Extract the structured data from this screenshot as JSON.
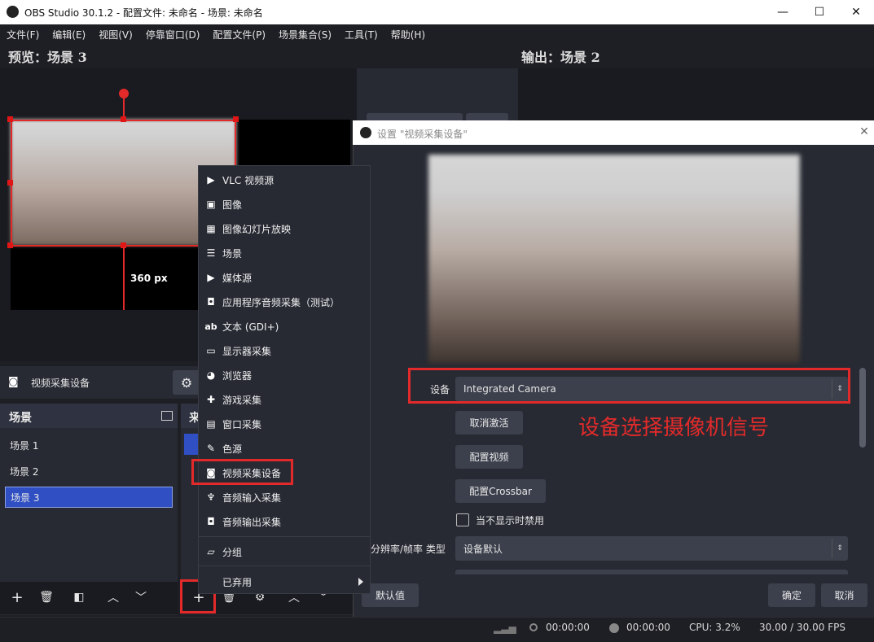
{
  "window": {
    "title": "OBS Studio 30.1.2 - 配置文件: 未命名 - 场景: 未命名",
    "minimize": "—",
    "maximize": "☐",
    "close": "✕"
  },
  "menu": [
    "文件(F)",
    "编辑(E)",
    "视图(V)",
    "停靠窗口(D)",
    "配置文件(P)",
    "场景集合(S)",
    "工具(T)",
    "帮助(H)"
  ],
  "preview": {
    "label": "预览：场景 3",
    "size_label": "360 px"
  },
  "program": {
    "label": "输出：场景 2"
  },
  "source_bar": {
    "name": "视频采集设备"
  },
  "scenes": {
    "title": "场景",
    "items": [
      "场景 1",
      "场景 2",
      "场景 3"
    ],
    "selected_index": 2
  },
  "sources_panel": {
    "title_partial": "来"
  },
  "context_menu": {
    "items": [
      {
        "icon": "play-icon",
        "label": "VLC 视频源"
      },
      {
        "icon": "image-icon",
        "label": "图像"
      },
      {
        "icon": "slideshow-icon",
        "label": "图像幻灯片放映"
      },
      {
        "icon": "list-icon",
        "label": "场景"
      },
      {
        "icon": "play-icon",
        "label": "媒体源"
      },
      {
        "icon": "speaker-icon",
        "label": "应用程序音频采集（测试）"
      },
      {
        "icon": "text-icon",
        "label": "文本 (GDI+)"
      },
      {
        "icon": "monitor-icon",
        "label": "显示器采集"
      },
      {
        "icon": "globe-icon",
        "label": "浏览器"
      },
      {
        "icon": "gamepad-icon",
        "label": "游戏采集"
      },
      {
        "icon": "window-icon",
        "label": "窗口采集"
      },
      {
        "icon": "brush-icon",
        "label": "色源"
      },
      {
        "icon": "camera-icon",
        "label": "视频采集设备"
      },
      {
        "icon": "microphone-icon",
        "label": "音频输入采集"
      },
      {
        "icon": "speaker-icon",
        "label": "音频输出采集"
      }
    ],
    "group_label": "分组",
    "deprecated_label": "已弃用",
    "text_icon_glyph": "ab"
  },
  "dialog": {
    "title": "设置 \"视频采集设备\"",
    "device_label": "设备",
    "device_value": "Integrated Camera",
    "deactivate_button": "取消激活",
    "configure_video_button": "配置视频",
    "configure_crossbar_button": "配置Crossbar",
    "checkbox_label": "当不显示时禁用",
    "resolution_label": "分辨率/帧率 类型",
    "resolution_value": "设备默认",
    "defaults_button": "默认值",
    "ok_button": "确定",
    "cancel_button": "取消",
    "annotation": "设备选择摄像机信号"
  },
  "status": {
    "stream_time": "00:00:00",
    "record_time": "00:00:00",
    "cpu": "CPU: 3.2%",
    "fps": "30.00 / 30.00 FPS"
  },
  "colors": {
    "annotation_red": "#e32a2a",
    "selection_blue": "#2f4fc2",
    "window_bg": "#1e1f24"
  }
}
